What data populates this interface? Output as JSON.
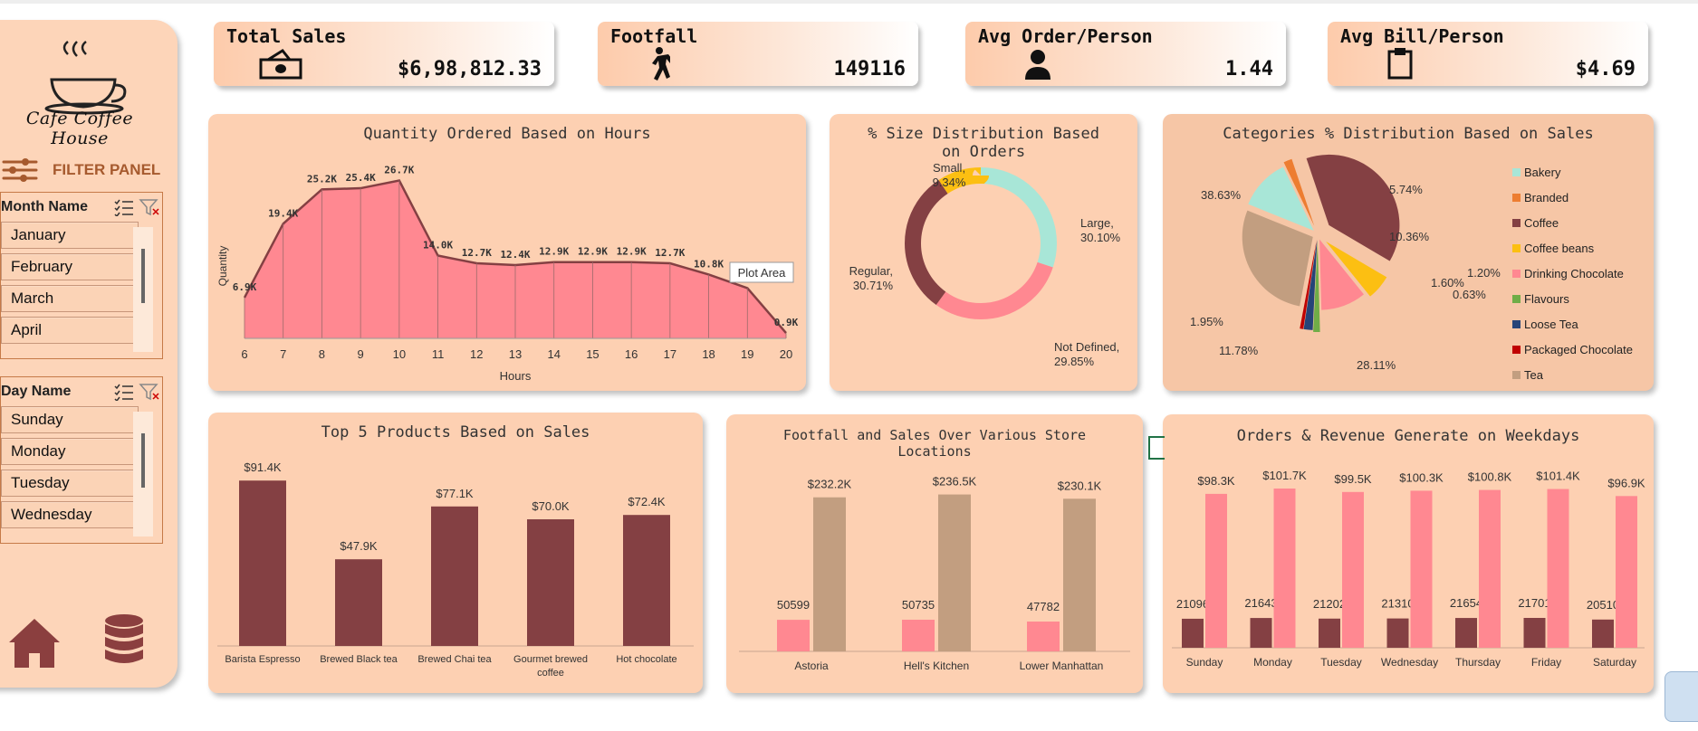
{
  "sidebar": {
    "logo_text": "Cafe Coffee House",
    "filter_label": "FILTER PANEL",
    "month_slicer": {
      "title": "Month Name",
      "items": [
        "January",
        "February",
        "March",
        "April"
      ]
    },
    "day_slicer": {
      "title": "Day Name",
      "items": [
        "Sunday",
        "Monday",
        "Tuesday",
        "Wednesday"
      ]
    }
  },
  "kpis": [
    {
      "title": "Total Sales",
      "value": "$6,98,812.33",
      "icon": "cash-icon"
    },
    {
      "title": "Footfall",
      "value": "149116",
      "icon": "walking-person-icon"
    },
    {
      "title": "Avg Order/Person",
      "value": "1.44",
      "icon": "person-icon"
    },
    {
      "title": "Avg Bill/Person",
      "value": "$4.69",
      "icon": "clipboard-icon"
    }
  ],
  "charts": {
    "hours": {
      "title": "Quantity Ordered Based on Hours",
      "tooltip": "Plot Area"
    },
    "size": {
      "title_line1": "% Size Distribution Based",
      "title_line2": "on Orders"
    },
    "categories": {
      "title": "Categories % Distribution Based on Sales"
    },
    "top5": {
      "title": "Top 5 Products Based on Sales"
    },
    "stores": {
      "title_line1": "Footfall and Sales Over Various Store",
      "title_line2": "Locations"
    },
    "weekdays": {
      "title": "Orders & Revenue Generate on Weekdays"
    }
  },
  "colors": {
    "pink": "#ff8891",
    "maroon": "#844043",
    "tan": "#c29e80",
    "panel": "#fdd0b2"
  },
  "chart_data": [
    {
      "type": "area",
      "x": [
        6,
        7,
        8,
        9,
        10,
        11,
        12,
        13,
        14,
        15,
        16,
        17,
        18,
        19,
        20
      ],
      "values": [
        6.9,
        19.4,
        25.2,
        25.4,
        26.7,
        14.0,
        12.7,
        12.4,
        12.9,
        12.9,
        12.9,
        12.7,
        10.8,
        8.5,
        0.9
      ],
      "labels": [
        "6.9K",
        "19.4K",
        "25.2K",
        "25.4K",
        "26.7K",
        "14.0K",
        "12.7K",
        "12.4K",
        "12.9K",
        "12.9K",
        "12.9K",
        "12.7K",
        "10.8K",
        "",
        "0.9K"
      ],
      "xlabel": "Hours",
      "ylabel": "Quantity",
      "ylim": [
        0,
        30
      ]
    },
    {
      "type": "pie",
      "categories": [
        "Large",
        "Not Defined",
        "Regular",
        "Small"
      ],
      "values": [
        30.1,
        29.85,
        30.71,
        9.34
      ],
      "labels": [
        "Large,\n30.10%",
        "Not Defined,\n29.85%",
        "Regular,\n30.71%",
        "Small,\n9.34%"
      ],
      "colors": [
        "#a8e6d7",
        "#ff8891",
        "#844043",
        "#fcbf12"
      ]
    },
    {
      "type": "pie",
      "categories": [
        "Bakery",
        "Branded",
        "Coffee",
        "Coffee beans",
        "Drinking Chocolate",
        "Flavours",
        "Loose Tea",
        "Packaged Chocolate",
        "Tea"
      ],
      "values": [
        11.78,
        1.95,
        38.63,
        5.74,
        10.36,
        1.2,
        1.6,
        0.63,
        28.11
      ],
      "labels": [
        "11.78%",
        "1.95%",
        "38.63%",
        "5.74%",
        "10.36%",
        "1.20%",
        "1.60%",
        "0.63%",
        "28.11%"
      ],
      "colors": [
        "#a8e6d7",
        "#ed7d31",
        "#844043",
        "#fcbf12",
        "#ff8891",
        "#70ad47",
        "#264478",
        "#c00000",
        "#c29e80"
      ]
    },
    {
      "type": "bar",
      "categories": [
        "Barista Espresso",
        "Brewed Black tea",
        "Brewed Chai tea",
        "Gourmet brewed coffee",
        "Hot chocolate"
      ],
      "values": [
        91.4,
        47.9,
        77.1,
        70.0,
        72.4
      ],
      "labels": [
        "$91.4K",
        "$47.9K",
        "$77.1K",
        "$70.0K",
        "$72.4K"
      ],
      "ylim": [
        0,
        100
      ]
    },
    {
      "type": "bar",
      "categories": [
        "Astoria",
        "Hell's Kitchen",
        "Lower Manhattan"
      ],
      "series": [
        {
          "values": [
            50599,
            50735,
            47782
          ],
          "labels": [
            "50599",
            "50735",
            "47782"
          ]
        },
        {
          "values": [
            232.2,
            236.5,
            230.1
          ],
          "labels": [
            "$232.2K",
            "$236.5K",
            "$230.1K"
          ]
        }
      ]
    },
    {
      "type": "bar",
      "categories": [
        "Sunday",
        "Monday",
        "Tuesday",
        "Wednesday",
        "Thursday",
        "Friday",
        "Saturday"
      ],
      "series": [
        {
          "values": [
            21096,
            21643,
            21202,
            21310,
            21654,
            21701,
            20510
          ],
          "labels": [
            "21096",
            "21643",
            "21202",
            "21310",
            "21654",
            "21701",
            "20510"
          ]
        },
        {
          "values": [
            98.3,
            101.7,
            99.5,
            100.3,
            100.8,
            101.4,
            96.9
          ],
          "labels": [
            "$98.3K",
            "$101.7K",
            "$99.5K",
            "$100.3K",
            "$100.8K",
            "$101.4K",
            "$96.9K"
          ]
        }
      ]
    }
  ]
}
